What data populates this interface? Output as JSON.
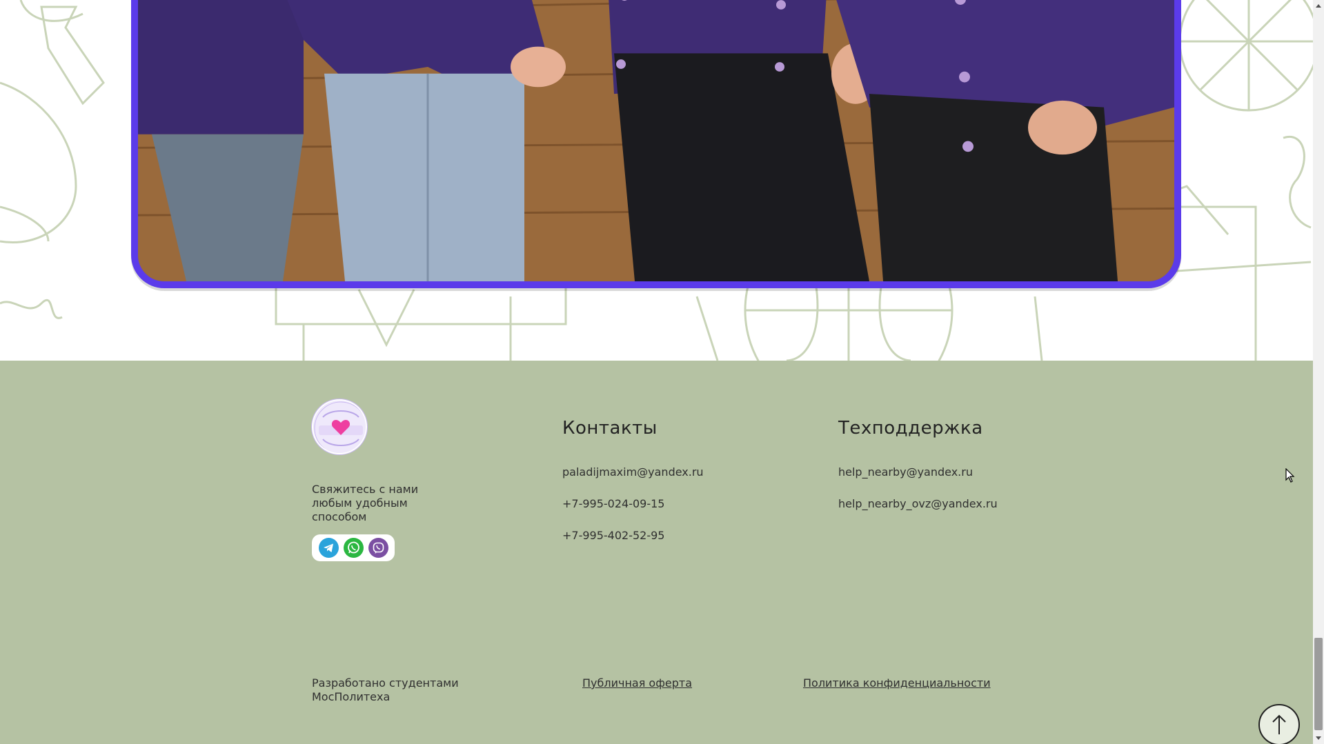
{
  "colors": {
    "footer_bg": "#b5c2a3",
    "frame_accent": "#5b3bea",
    "doodle_stroke": "#c9d4b8",
    "text": "#2f2f2f"
  },
  "hero": {
    "photo_icon": "group-photo-purple-jackets"
  },
  "footer": {
    "logo_icon": "heart-hands-logo-icon",
    "tagline": "Свяжитесь с нами любым удобным способом",
    "socials": [
      {
        "name": "telegram-icon",
        "color": "#2aa3db"
      },
      {
        "name": "whatsapp-icon",
        "color": "#2bb741"
      },
      {
        "name": "viber-icon",
        "color": "#7b4fa2"
      }
    ],
    "contacts": {
      "title": "Контакты",
      "email": "paladijmaxim@yandex.ru",
      "phone1": "+7-995-024-09-15",
      "phone2": "+7-995-402-52-95"
    },
    "support": {
      "title": "Техподдержка",
      "email1": "help_nearby@yandex.ru",
      "email2": "help_nearby_ovz@yandex.ru"
    },
    "bottom": {
      "developed_by": "Разработано студентами МосПолитеха",
      "public_offer": "Публичная оферта",
      "privacy_policy": "Политика конфиденциальности"
    }
  },
  "scroll_top_icon": "arrow-up-icon"
}
